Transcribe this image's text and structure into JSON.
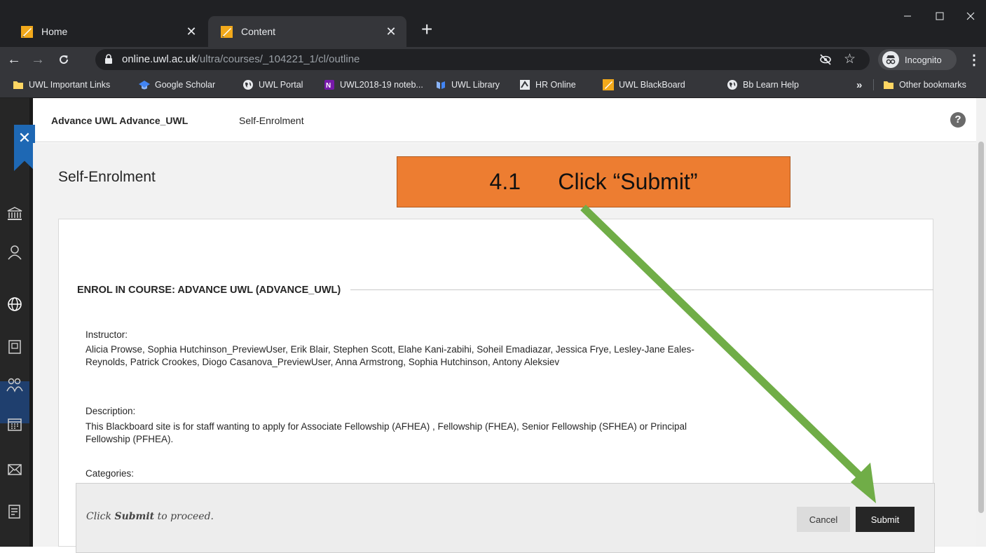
{
  "browser": {
    "tabs": [
      {
        "title": "Home",
        "active": false,
        "close_glyph": "✕"
      },
      {
        "title": "Content",
        "active": true,
        "close_glyph": "✕"
      }
    ],
    "new_tab_glyph": "+",
    "window_controls": {
      "minimize": "—",
      "maximize": "☐",
      "close": "✕"
    },
    "nav": {
      "back": "←",
      "forward": "→",
      "reload": "C"
    },
    "url_host": "online.uwl.ac.uk",
    "url_path": "/ultra/courses/_104221_1/cl/outline",
    "incognito_label": "Incognito",
    "menu_glyph": "⋮",
    "star_glyph": "☆",
    "bookmarks": [
      {
        "label": "UWL Important Links",
        "icon": "folder-icon"
      },
      {
        "label": "Google Scholar",
        "icon": "graduation-cap-icon"
      },
      {
        "label": "UWL Portal",
        "icon": "globe-icon"
      },
      {
        "label": "UWL2018-19 noteb...",
        "icon": "onenote-icon"
      },
      {
        "label": "UWL Library",
        "icon": "library-icon"
      },
      {
        "label": "HR Online",
        "icon": "hr-icon"
      },
      {
        "label": "UWL BlackBoard",
        "icon": "blackboard-icon"
      },
      {
        "label": "Bb Learn Help",
        "icon": "globe-icon"
      }
    ],
    "bookmarks_overflow": "»",
    "other_bookmarks": "Other bookmarks"
  },
  "bb": {
    "course_name": "Advance UWL Advance_UWL",
    "breadcrumb_page": "Self-Enrolment",
    "help_glyph": "?",
    "close_glyph": "✕",
    "page_title": "Self-Enrolment",
    "section_heading": "ENROL IN COURSE: ADVANCE UWL (ADVANCE_UWL)",
    "instructor_label": "Instructor:",
    "instructor_text": "Alicia Prowse, Sophia Hutchinson_PreviewUser, Erik Blair, Stephen Scott, Elahe Kani-zabihi, Soheil Emadiazar, Jessica Frye, Lesley-Jane Eales-Reynolds, Patrick Crookes, Diogo Casanova_PreviewUser, Anna Armstrong, Sophia Hutchinson, Antony Aleksiev",
    "description_label": "Description:",
    "description_text": "This Blackboard site is for staff wanting to apply for Associate Fellowship (AFHEA) , Fellowship (FHEA), Senior Fellowship (SFHEA) or Principal Fellowship (PFHEA).",
    "categories_label": "Categories:",
    "footer_hint_pre": "Click ",
    "footer_hint_bold": "Submit",
    "footer_hint_post": " to proceed.",
    "cancel_label": "Cancel",
    "submit_label": "Submit"
  },
  "annotation": {
    "callout_step": "4.1",
    "callout_text": "Click “Submit”",
    "callout_color": "#ed7d31",
    "arrow_color": "#70ad47"
  }
}
